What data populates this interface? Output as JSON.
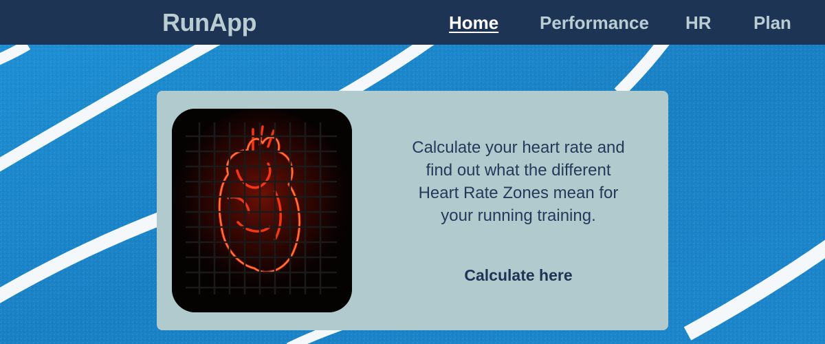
{
  "navbar": {
    "brand": "RunApp",
    "links": [
      {
        "label": "Home",
        "active": true
      },
      {
        "label": "Performance",
        "active": false
      },
      {
        "label": "HR",
        "active": false
      },
      {
        "label": "Plan",
        "active": false
      }
    ]
  },
  "card": {
    "description": "Calculate your heart rate and find out what the different Heart Rate Zones mean for your running training.",
    "link_label": "Calculate here",
    "image_icon": "neon-heart-icon"
  },
  "colors": {
    "navbar_bg": "#1e3455",
    "nav_text": "#b9cdd3",
    "card_bg": "#b1cacd",
    "text_dark": "#243a5a",
    "track_blue": "#1a86c9"
  }
}
